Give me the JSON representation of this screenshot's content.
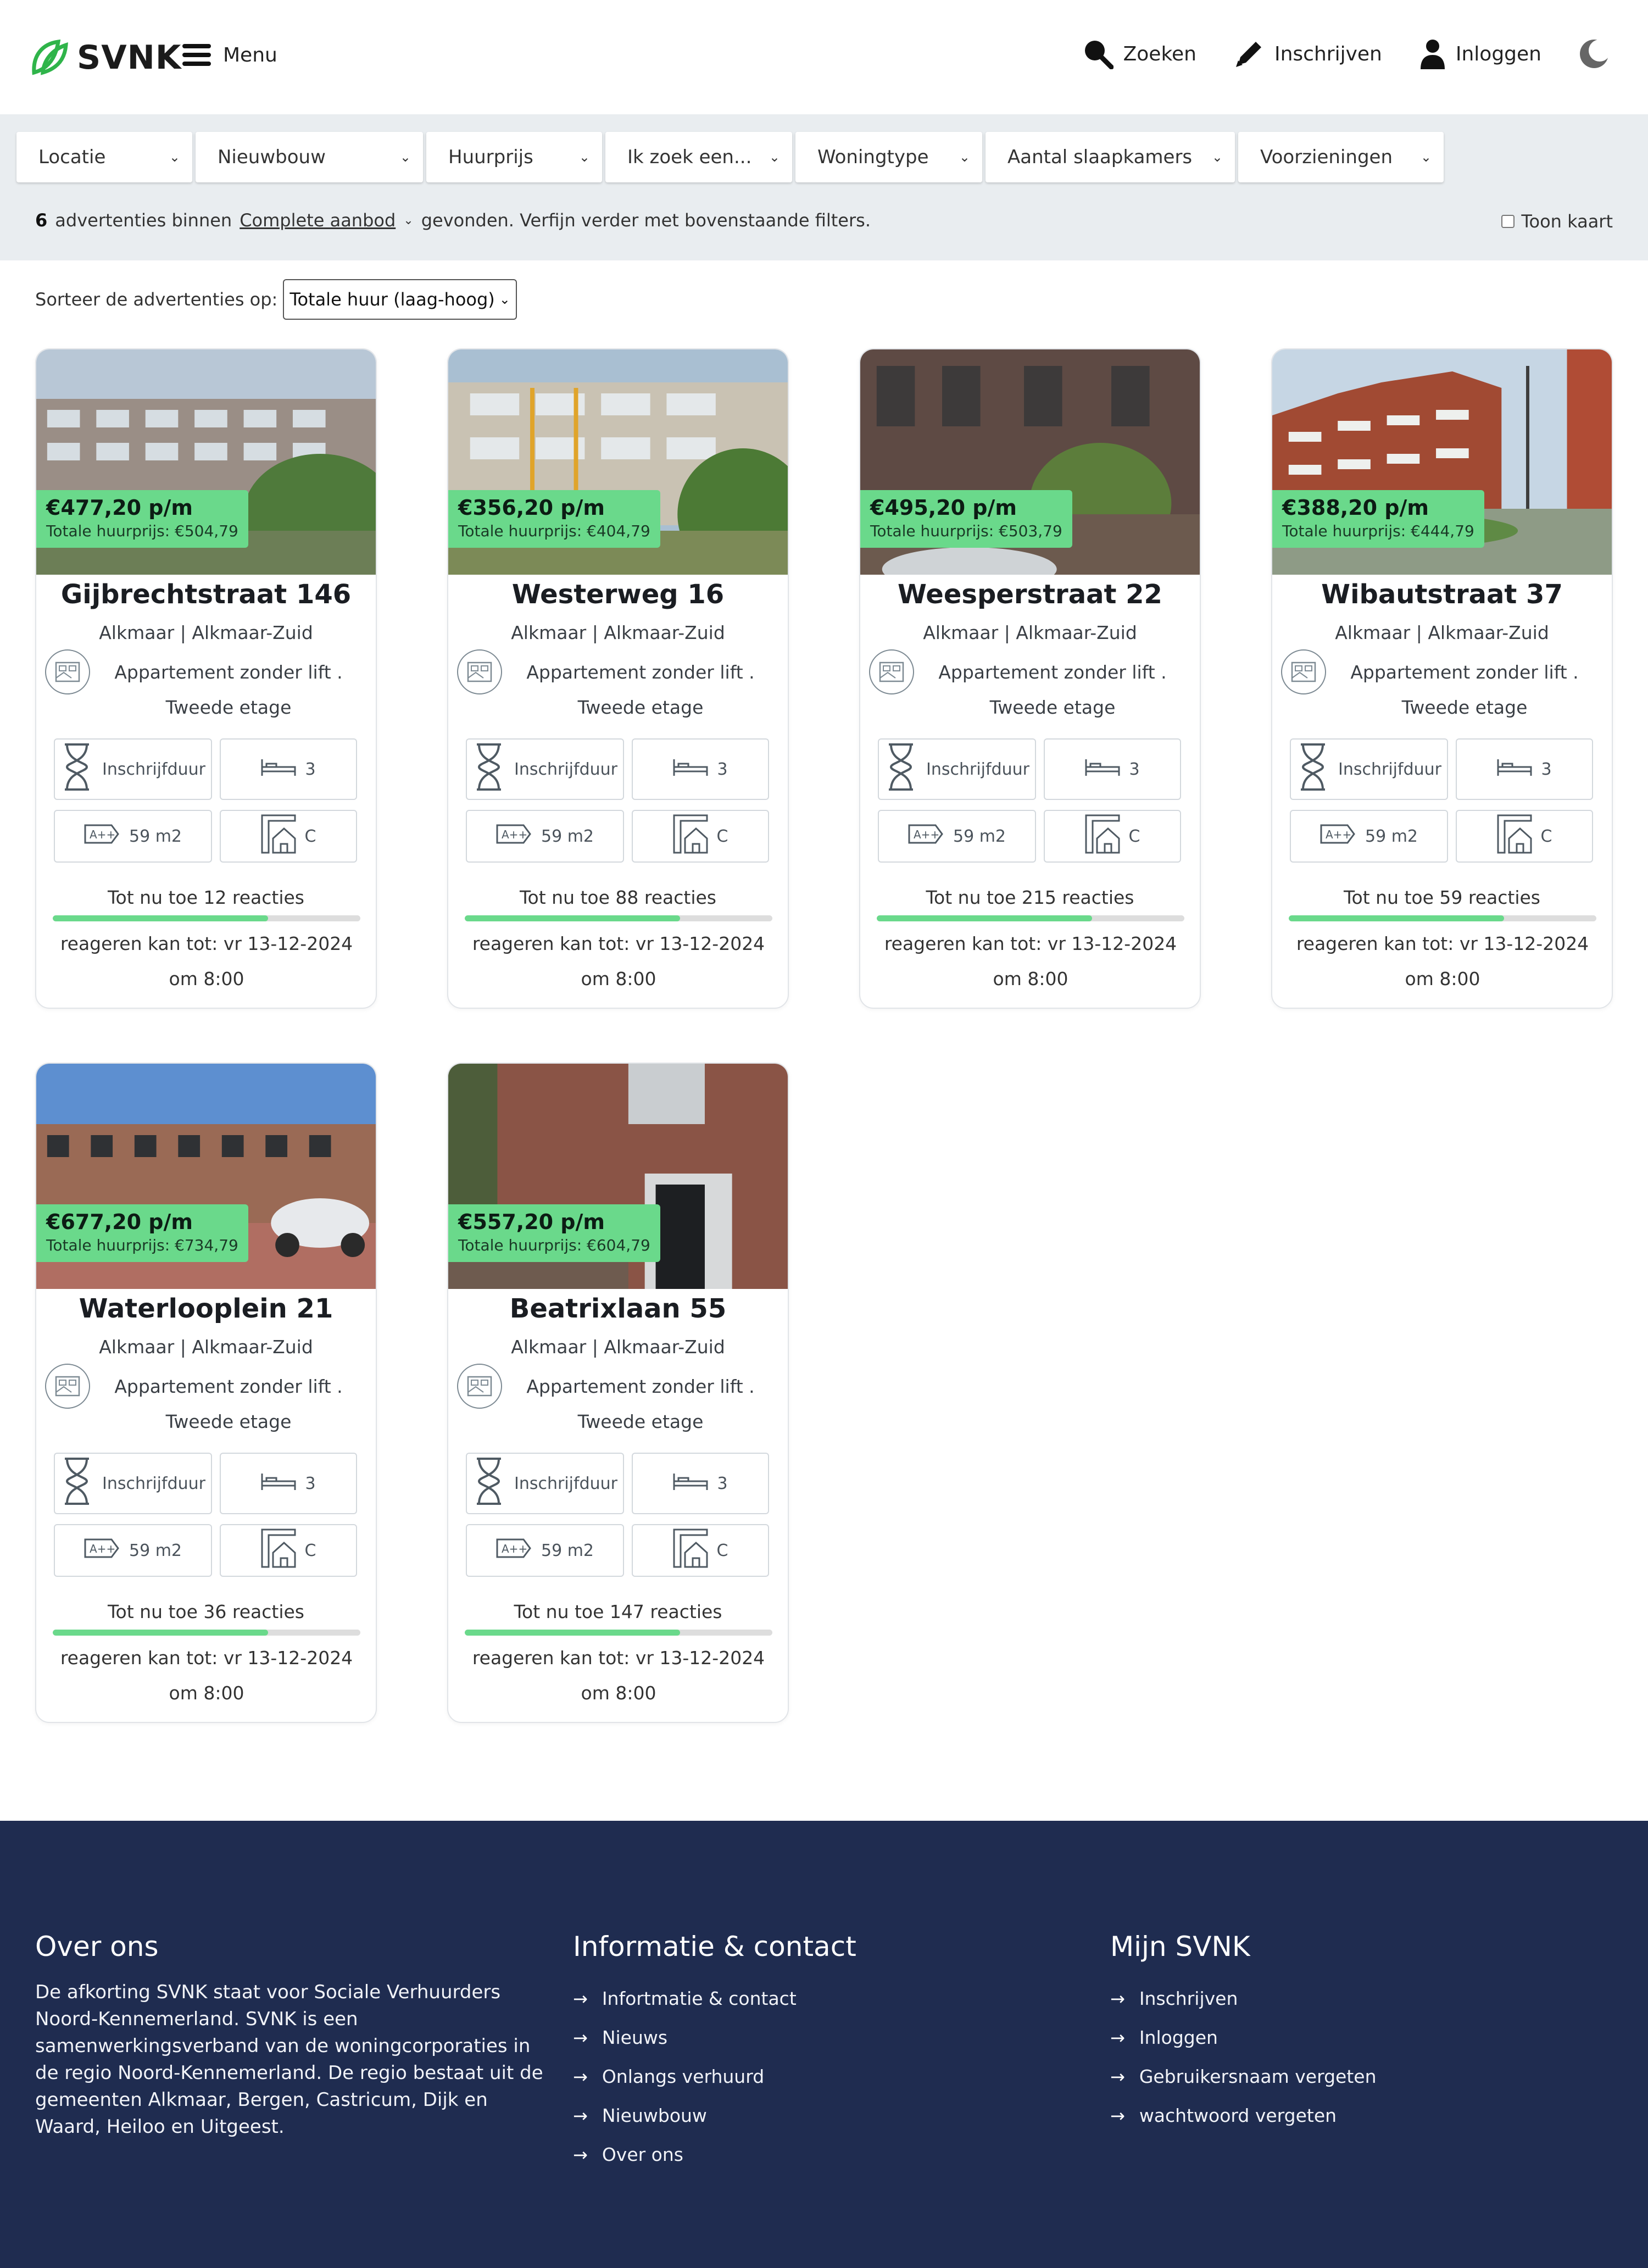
{
  "header": {
    "logo_text": "SVNK",
    "menu_label": "Menu",
    "nav": {
      "search": "Zoeken",
      "register": "Inschrijven",
      "login": "Inloggen"
    }
  },
  "filters": [
    "Locatie",
    "Nieuwbouw",
    "Huurprijs",
    "Ik zoek een...",
    "Woningtype",
    "Aantal slaapkamers",
    "Voorzieningen"
  ],
  "results": {
    "count": "6",
    "text_before": "advertenties binnen",
    "scope": "Complete aanbod",
    "text_after": "gevonden. Verfijn verder met bovenstaande filters.",
    "map_toggle": "Toon kaart"
  },
  "sort": {
    "label": "Sorteer de advertenties op:",
    "value": "Totale huur (laag-hoog)"
  },
  "listings": [
    {
      "price": "€477,20 p/m",
      "total": "Totale huurprijs: €504,79",
      "title": "Gijbrechtstraat 146",
      "city": "Alkmaar | Alkmaar-Zuid",
      "type": "Appartement zonder lift .",
      "floor": "Tweede etage",
      "duration": "Inschrijfduur",
      "bedrooms": "3",
      "area": "59 m2",
      "energy": "C",
      "reactions": "Tot nu toe 12 reacties",
      "progress": 0.7,
      "deadline": "reageren kan tot: vr 13-12-2024 om 8:00"
    },
    {
      "price": "€356,20 p/m",
      "total": "Totale huurprijs: €404,79",
      "title": "Westerweg 16",
      "city": "Alkmaar | Alkmaar-Zuid",
      "type": "Appartement zonder lift .",
      "floor": "Tweede etage",
      "duration": "Inschrijfduur",
      "bedrooms": "3",
      "area": "59 m2",
      "energy": "C",
      "reactions": "Tot nu toe 88 reacties",
      "progress": 0.7,
      "deadline": "reageren kan tot: vr 13-12-2024 om 8:00"
    },
    {
      "price": "€495,20 p/m",
      "total": "Totale huurprijs: €503,79",
      "title": "Weesperstraat 22",
      "city": "Alkmaar | Alkmaar-Zuid",
      "type": "Appartement zonder lift .",
      "floor": "Tweede etage",
      "duration": "Inschrijfduur",
      "bedrooms": "3",
      "area": "59 m2",
      "energy": "C",
      "reactions": "Tot nu toe 215 reacties",
      "progress": 0.7,
      "deadline": "reageren kan tot: vr 13-12-2024 om 8:00"
    },
    {
      "price": "€388,20 p/m",
      "total": "Totale huurprijs: €444,79",
      "title": "Wibautstraat 37",
      "city": "Alkmaar | Alkmaar-Zuid",
      "type": "Appartement zonder lift .",
      "floor": "Tweede etage",
      "duration": "Inschrijfduur",
      "bedrooms": "3",
      "area": "59 m2",
      "energy": "C",
      "reactions": "Tot nu toe 59 reacties",
      "progress": 0.7,
      "deadline": "reageren kan tot: vr 13-12-2024 om 8:00"
    },
    {
      "price": "€677,20 p/m",
      "total": "Totale huurprijs: €734,79",
      "title": "Waterlooplein 21",
      "city": "Alkmaar | Alkmaar-Zuid",
      "type": "Appartement zonder lift .",
      "floor": "Tweede etage",
      "duration": "Inschrijfduur",
      "bedrooms": "3",
      "area": "59 m2",
      "energy": "C",
      "reactions": "Tot nu toe 36 reacties",
      "progress": 0.7,
      "deadline": "reageren kan tot: vr 13-12-2024 om 8:00"
    },
    {
      "price": "€557,20 p/m",
      "total": "Totale huurprijs: €604,79",
      "title": "Beatrixlaan 55",
      "city": "Alkmaar | Alkmaar-Zuid",
      "type": "Appartement zonder lift .",
      "floor": "Tweede etage",
      "duration": "Inschrijfduur",
      "bedrooms": "3",
      "area": "59 m2",
      "energy": "C",
      "reactions": "Tot nu toe 147 reacties",
      "progress": 0.7,
      "deadline": "reageren kan tot: vr 13-12-2024 om 8:00"
    }
  ],
  "footer": {
    "about_title": "Over ons",
    "about_text": "De afkorting SVNK staat voor Sociale Verhuurders Noord-Kennemerland. SVNK is een samenwerkingsverband van de woningcorporaties in de regio Noord-Kennemerland. De regio bestaat uit de gemeenten Alkmaar, Bergen, Castricum, Dijk en Waard, Heiloo en Uitgeest.",
    "info_title": "Informatie & contact",
    "info_links": [
      "Infortmatie & contact",
      "Nieuws",
      "Onlangs verhuurd",
      "Nieuwbouw",
      "Over ons"
    ],
    "my_title": "Mijn SVNK",
    "my_links": [
      "Inschrijven",
      "Inloggen",
      "Gebruikersnaam vergeten",
      "wachtwoord vergeten"
    ]
  },
  "colors": {
    "accent": "#6ad98b",
    "brand_green": "#2fb44a",
    "footer_bg": "#1f2c50",
    "filter_bg": "#e9edf0"
  }
}
